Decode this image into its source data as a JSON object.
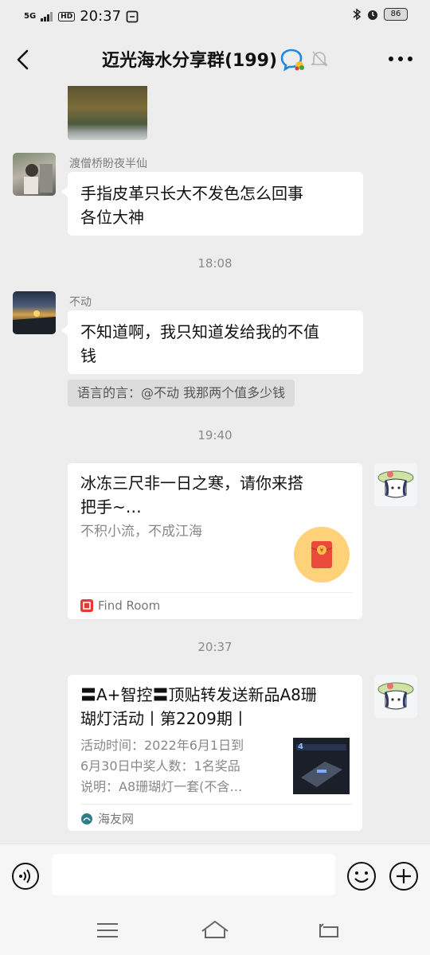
{
  "status_bar": {
    "network": "5G",
    "hd": "HD",
    "time": "20:37",
    "battery": "86"
  },
  "header": {
    "title": "迈光海水分享群(199)"
  },
  "messages": {
    "m1": {
      "nickname": "渡僧桥盼夜半仙",
      "text_line1": "手指皮革只长大不发色怎么回事",
      "text_line2": "各位大神"
    },
    "t1": "18:08",
    "m2": {
      "nickname": "不动",
      "text_line1": "不知道啊，我只知道发给我的不值",
      "text_line2": "钱"
    },
    "quote": "语言的言：@不动 我那两个值多少钱",
    "t2": "19:40",
    "card1": {
      "title_line1": "冰冻三尺非一日之寒，请你来搭",
      "title_line2": "把手~…",
      "desc": "不积小流，不成江海",
      "source": "Find Room"
    },
    "t3": "20:37",
    "card2": {
      "title_line1": "〓A+智控〓顶贴转发送新品A8珊",
      "title_line2": "瑚灯活动丨第2209期丨",
      "desc_line1": "活动时间：2022年6月1日到",
      "desc_line2": "6月30日中奖人数：1名奖品",
      "desc_line3": "说明：A8珊瑚灯一套(不含…",
      "source": "海友网"
    }
  },
  "icons": {
    "back": "back-arrow-icon",
    "chat": "group-chat-icon",
    "mute": "bell-off-icon",
    "more": "more-dots-icon",
    "voice": "voice-icon",
    "emoji": "emoji-icon",
    "plus": "plus-icon",
    "nav_menu": "menu-icon",
    "nav_home": "home-icon",
    "nav_back": "return-icon"
  },
  "colors": {
    "background": "#ededed",
    "bubble": "#ffffff",
    "red_packet": "#e94a3c"
  }
}
